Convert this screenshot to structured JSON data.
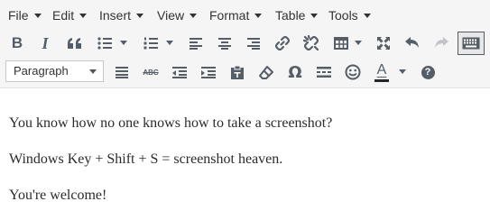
{
  "menubar": {
    "file": "File",
    "edit": "Edit",
    "insert": "Insert",
    "view": "View",
    "format": "Format",
    "table": "Table",
    "tools": "Tools"
  },
  "toolbar": {
    "bold_glyph": "B",
    "italic_glyph": "I",
    "format_select": "Paragraph",
    "strikethrough_glyph": "ABC",
    "special_char_glyph": "Ω",
    "text_color_glyph": "A",
    "text_color_value": "#23282d",
    "help_glyph": "?"
  },
  "content": {
    "paragraphs": [
      "You know how no one knows how to take a screenshot?",
      "Windows Key + Shift + S = screenshot heaven.",
      "You're welcome!"
    ]
  },
  "icons": {
    "toolbar_row1": [
      "bold-icon",
      "italic-icon",
      "blockquote-icon",
      "bullet-list-icon",
      "numbered-list-icon",
      "align-left-icon",
      "align-center-icon",
      "align-right-icon",
      "link-icon",
      "unlink-icon",
      "table-icon",
      "fullscreen-icon",
      "undo-icon",
      "redo-icon",
      "keyboard-icon"
    ],
    "toolbar_row2": [
      "justify-icon",
      "strikethrough-icon",
      "outdent-icon",
      "indent-icon",
      "paste-as-text-icon",
      "clear-formatting-icon",
      "omega-icon",
      "read-more-icon",
      "emoji-icon",
      "text-color-icon",
      "help-icon"
    ]
  },
  "colors": {
    "toolbar_bg": "#f5f5f5",
    "icon": "#555d66",
    "active_border": "#555d66",
    "content_bg": "#ffffff",
    "text": "#2b2b2b"
  }
}
